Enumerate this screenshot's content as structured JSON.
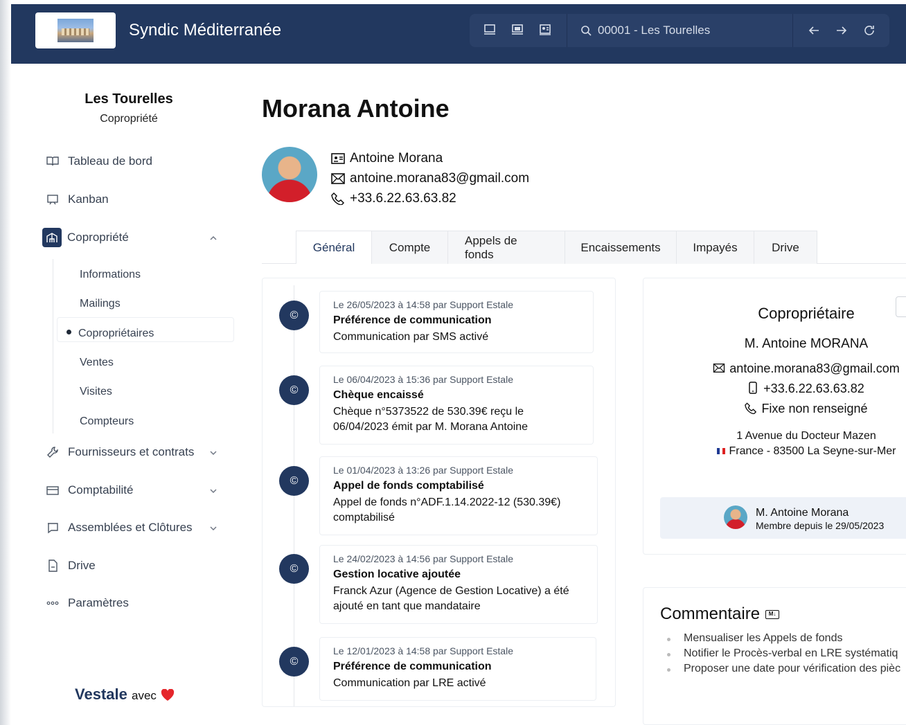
{
  "header": {
    "brand": "Syndic Méditerranée",
    "search_value": "00001 - Les Tourelles"
  },
  "sidebar": {
    "property_name": "Les Tourelles",
    "property_type": "Copropriété",
    "items": [
      {
        "label": "Tableau de bord"
      },
      {
        "label": "Kanban"
      },
      {
        "label": "Copropriété"
      },
      {
        "label": "Fournisseurs et contrats"
      },
      {
        "label": "Comptabilité"
      },
      {
        "label": "Assemblées et Clôtures"
      },
      {
        "label": "Drive"
      },
      {
        "label": "Paramètres"
      }
    ],
    "sub_items": [
      {
        "label": "Informations"
      },
      {
        "label": "Mailings"
      },
      {
        "label": "Copropriétaires"
      },
      {
        "label": "Ventes"
      },
      {
        "label": "Visites"
      },
      {
        "label": "Compteurs"
      }
    ],
    "footer_brand": "estale",
    "footer_avec": "avec"
  },
  "person": {
    "name": "Morana Antoine",
    "display_name": "Antoine Morana",
    "email": "antoine.morana83@gmail.com",
    "phone": "+33.6.22.63.63.82"
  },
  "tabs": [
    {
      "label": "Général"
    },
    {
      "label": "Compte"
    },
    {
      "label": "Appels de fonds"
    },
    {
      "label": "Encaissements"
    },
    {
      "label": "Impayés"
    },
    {
      "label": "Drive"
    }
  ],
  "timeline": [
    {
      "meta": "Le 26/05/2023 à 14:58 par Support Estale",
      "title": "Préférence de communication",
      "desc": "Communication par SMS activé"
    },
    {
      "meta": "Le 06/04/2023 à 15:36 par Support Estale",
      "title": "Chèque encaissé",
      "desc": "Chèque n°5373522 de 530.39€ reçu le 06/04/2023 émit par M. Morana Antoine"
    },
    {
      "meta": "Le 01/04/2023 à 13:26 par Support Estale",
      "title": "Appel de fonds comptabilisé",
      "desc": "Appel de fonds n°ADF.1.14.2022-12 (530.39€) comptabilisé"
    },
    {
      "meta": "Le 24/02/2023 à 14:56 par Support Estale",
      "title": "Gestion locative ajoutée",
      "desc": "Franck Azur (Agence de Gestion Locative) a été ajouté en tant que mandataire"
    },
    {
      "meta": "Le 12/01/2023 à 14:58 par Support Estale",
      "title": "Préférence de communication",
      "desc": "Communication par LRE activé"
    }
  ],
  "owner": {
    "heading": "Copropriétaire",
    "name": "M. Antoine MORANA",
    "email": "antoine.morana83@gmail.com",
    "mobile": "+33.6.22.63.63.82",
    "landline": "Fixe non renseigné",
    "address_line1": "1 Avenue du Docteur Mazen",
    "address_line2": "France - 83500 La Seyne-sur-Mer",
    "member_name": "M. Antoine Morana",
    "member_since": "Membre depuis le 29/05/2023"
  },
  "comment": {
    "title": "Commentaire",
    "badge": "M↓",
    "items": [
      "Mensualiser les Appels de fonds",
      "Notifier le Procès-verbal en LRE systématiq",
      "Proposer une date pour vérification des pièc"
    ]
  },
  "colors": {
    "primary": "#22385f",
    "heart": "#e5262b"
  }
}
